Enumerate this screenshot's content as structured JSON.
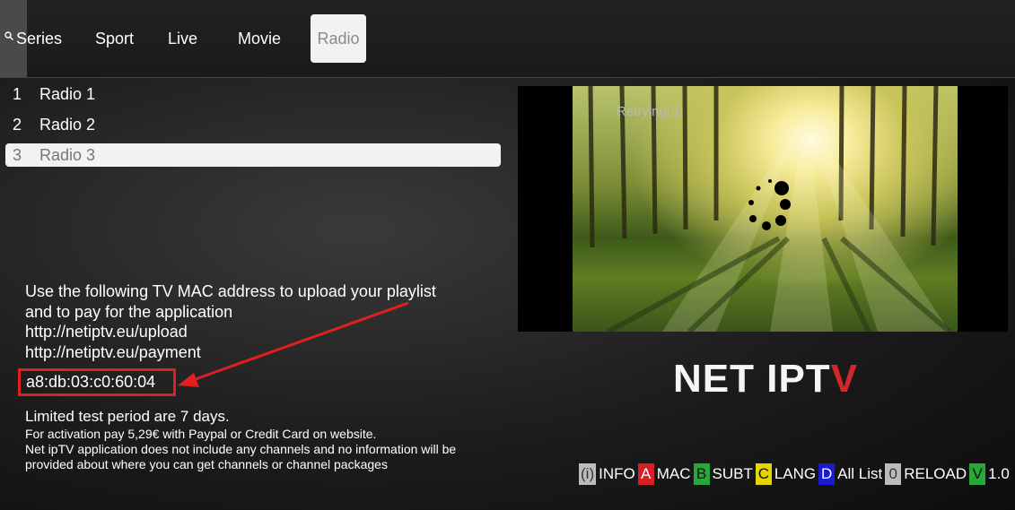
{
  "nav": {
    "tabs": [
      "Series",
      "Sport",
      "Live",
      "Movie",
      "Radio"
    ],
    "active_tab": "Radio"
  },
  "channels": [
    {
      "num": "1",
      "name": "Radio 1"
    },
    {
      "num": "2",
      "name": "Radio 2"
    },
    {
      "num": "3",
      "name": "Radio 3"
    }
  ],
  "selected_channel": "3",
  "info": {
    "line1": "Use the following TV MAC address to upload your playlist",
    "line2": "and to pay for the application",
    "upload_url": "http://netiptv.eu/upload",
    "payment_url": "http://netiptv.eu/payment",
    "mac": "a8:db:03:c0:60:04",
    "trial": "Limited test period are 7 days.",
    "activation": "For activation pay 5,29€ with Paypal or Credit Card on website.",
    "disclaimer1": "Net ipTV application does not include any channels and no information will be",
    "disclaimer2": "provided about where you can get channels or channel packages"
  },
  "player": {
    "status": "Retrying(3)"
  },
  "logo": {
    "main": "NET IPT",
    "accent": "V"
  },
  "legend": [
    {
      "key": "(i)",
      "label": "INFO",
      "color": "grey"
    },
    {
      "key": "A",
      "label": "MAC",
      "color": "red"
    },
    {
      "key": "B",
      "label": "SUBT",
      "color": "green"
    },
    {
      "key": "C",
      "label": "LANG",
      "color": "yellow"
    },
    {
      "key": "D",
      "label": "All List",
      "color": "blue"
    },
    {
      "key": "0",
      "label": "RELOAD",
      "color": "grey"
    },
    {
      "key": "V",
      "label": "1.0",
      "color": "green"
    }
  ],
  "colors": {
    "accent_red": "#d81f26",
    "highlight_box": "#e02020"
  }
}
